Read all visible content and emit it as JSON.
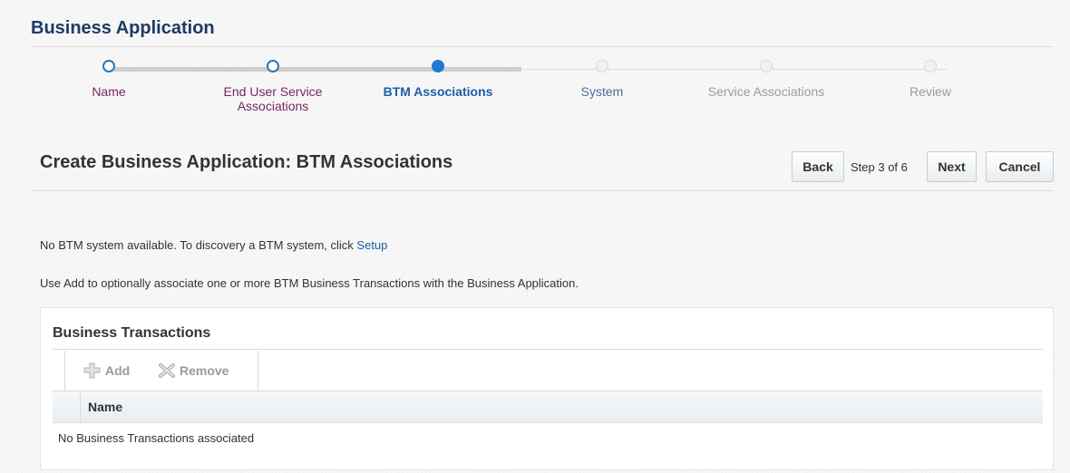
{
  "app_title": "Business Application",
  "train": {
    "stops": [
      {
        "label": "Name",
        "state": "visited"
      },
      {
        "label": "End User Service Associations",
        "state": "visited"
      },
      {
        "label": "BTM Associations",
        "state": "current"
      },
      {
        "label": "System",
        "state": "next"
      },
      {
        "label": "Service Associations",
        "state": "future"
      },
      {
        "label": "Review",
        "state": "future"
      }
    ]
  },
  "header": {
    "title": "Create Business Application: BTM Associations",
    "back_label": "Back",
    "step_text": "Step 3 of 6",
    "next_label": "Next",
    "cancel_label": "Cancel"
  },
  "messages": {
    "no_btm_prefix": "No BTM system available. To discovery a BTM system, click ",
    "setup_link": "Setup",
    "add_hint": "Use Add to optionally associate one or more BTM Business Transactions with the Business Application."
  },
  "panel": {
    "title": "Business Transactions",
    "toolbar": {
      "add_label": "Add",
      "add_icon": "add-icon",
      "remove_label": "Remove",
      "remove_icon": "remove-icon"
    },
    "table": {
      "columns": [
        "Name"
      ],
      "empty_text": "No Business Transactions associated"
    }
  },
  "colors": {
    "brand_title": "#1d3b63",
    "link": "#1d5ea7",
    "visited_label": "#7a2567",
    "current_stop": "#2378cd"
  }
}
